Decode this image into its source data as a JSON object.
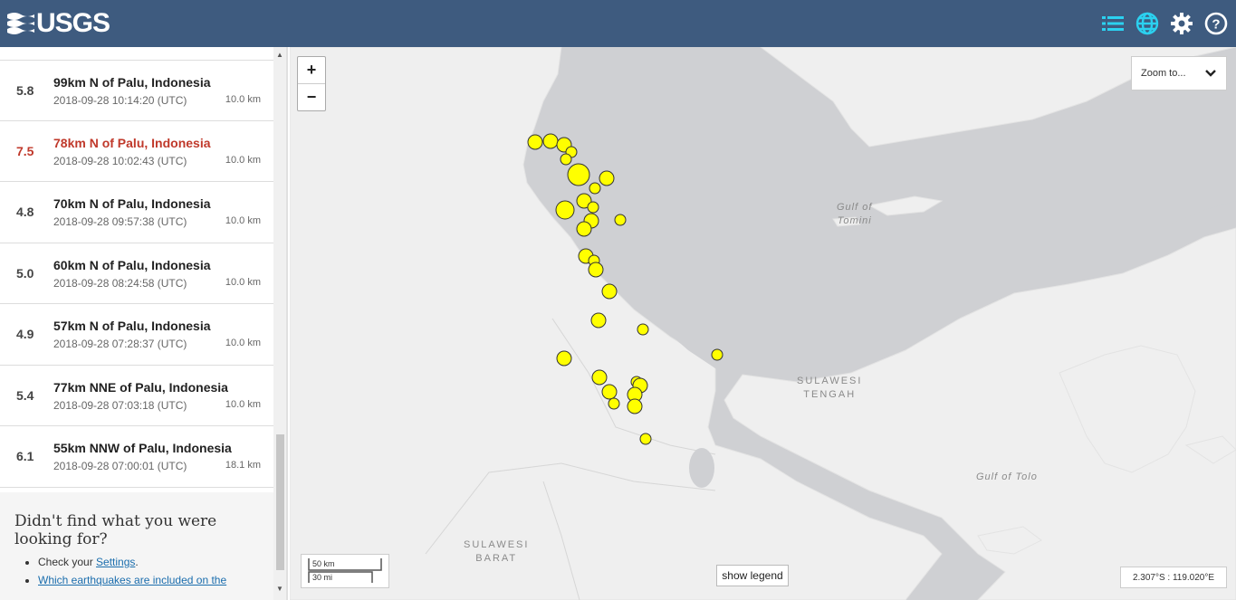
{
  "header": {
    "logo_text": "USGS",
    "icons": [
      "list-icon",
      "globe-icon",
      "gear-icon",
      "help-icon"
    ],
    "active_color": "#2bd1f0",
    "bar_color": "#3e5b7f"
  },
  "earthquakes": [
    {
      "mag": "5.8",
      "place": "99km N of Palu, Indonesia",
      "time": "2018-09-28 10:14:20 (UTC)",
      "depth": "10.0 km"
    },
    {
      "mag": "7.5",
      "place": "78km N of Palu, Indonesia",
      "time": "2018-09-28 10:02:43 (UTC)",
      "depth": "10.0 km",
      "significant": true
    },
    {
      "mag": "4.8",
      "place": "70km N of Palu, Indonesia",
      "time": "2018-09-28 09:57:38 (UTC)",
      "depth": "10.0 km"
    },
    {
      "mag": "5.0",
      "place": "60km N of Palu, Indonesia",
      "time": "2018-09-28 08:24:58 (UTC)",
      "depth": "10.0 km"
    },
    {
      "mag": "4.9",
      "place": "57km N of Palu, Indonesia",
      "time": "2018-09-28 07:28:37 (UTC)",
      "depth": "10.0 km"
    },
    {
      "mag": "5.4",
      "place": "77km NNE of Palu, Indonesia",
      "time": "2018-09-28 07:03:18 (UTC)",
      "depth": "10.0 km"
    },
    {
      "mag": "6.1",
      "place": "55km NNW of Palu, Indonesia",
      "time": "2018-09-28 07:00:01 (UTC)",
      "depth": "18.1 km"
    }
  ],
  "help": {
    "heading": "Didn't find what you were looking for?",
    "item1_prefix": "Check your ",
    "item1_link": "Settings",
    "item1_suffix": ".",
    "item2_link": "Which earthquakes are included on the"
  },
  "map": {
    "zoom_in": "+",
    "zoom_out": "−",
    "zoom_to": "Zoom to...",
    "scale_km": "50 km",
    "scale_mi": "30 mi",
    "legend_button": "show legend",
    "coordinates": "2.307°S : 119.020°E",
    "labels": {
      "gulf_tomini_1": "Gulf of",
      "gulf_tomini_2": "Tomini",
      "sulawesi_tengah_1": "SULAWESI",
      "sulawesi_tengah_2": "TENGAH",
      "gulf_tolo": "Gulf of Tolo",
      "sulawesi_barat_1": "SULAWESI",
      "sulawesi_barat_2": "BARAT"
    },
    "land_color": "#efefef",
    "sea_color": "#cfd0d3",
    "marker_color": "#ffff00"
  }
}
